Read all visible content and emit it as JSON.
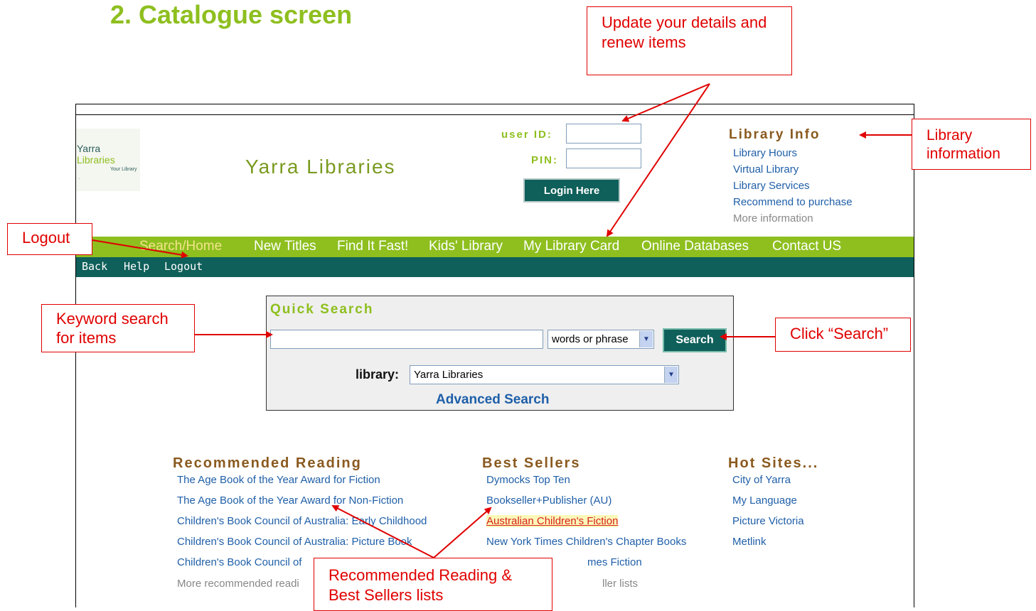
{
  "heading": "2. Catalogue screen",
  "logo": {
    "line1": "Yarra",
    "line2": "Libraries",
    "tagline": "Your Library",
    "dots": "."
  },
  "site_title": "Yarra Libraries",
  "login": {
    "user_id_label": "user ID:",
    "pin_label": "PIN:",
    "button": "Login Here"
  },
  "library_info": {
    "title": "Library Info",
    "links": [
      "Library Hours",
      "Virtual Library",
      "Library Services",
      "Recommend to purchase"
    ],
    "more": "More information"
  },
  "nav": [
    "Search/Home",
    "New Titles",
    "Find It Fast!",
    "Kids' Library",
    "My Library Card",
    "Online Databases",
    "Contact US"
  ],
  "subnav": [
    "Back",
    "Help",
    "Logout"
  ],
  "quick_search": {
    "title": "Quick Search",
    "search_value": "",
    "mode": "words or phrase",
    "button": "Search",
    "library_label": "library:",
    "library_value": "Yarra Libraries",
    "advanced": "Advanced Search"
  },
  "recommended": {
    "title": "Recommended Reading",
    "links": [
      "The Age Book of the Year Award for Fiction",
      "The Age Book of the Year Award for Non-Fiction",
      "Children's Book Council of Australia: Early Childhood",
      "Children's Book Council of Australia: Picture Book",
      "Children's Book Council of"
    ],
    "more": "More recommended readi"
  },
  "best_sellers": {
    "title": "Best Sellers",
    "links": [
      "Dymocks Top Ten",
      "Bookseller+Publisher (AU)",
      "Australian Children's Fiction",
      "New York Times Children's Chapter Books",
      "mes Fiction"
    ],
    "more": "ller lists"
  },
  "hot_sites": {
    "title": "Hot Sites...",
    "links": [
      "City of Yarra",
      "My Language",
      "Picture Victoria",
      "Metlink"
    ]
  },
  "annotations": {
    "update": "Update your details and renew items",
    "library_info": "Library information",
    "logout": "Logout",
    "keyword": "Keyword search for items",
    "click_search": "Click “Search”",
    "recommended": "Recommended Reading & Best Sellers lists"
  },
  "colors": {
    "accent": "#8ebf1f",
    "dark_teal": "#0f5f5a",
    "callout": "#e00000"
  },
  "icons": [
    "dropdown-arrow-icon"
  ]
}
